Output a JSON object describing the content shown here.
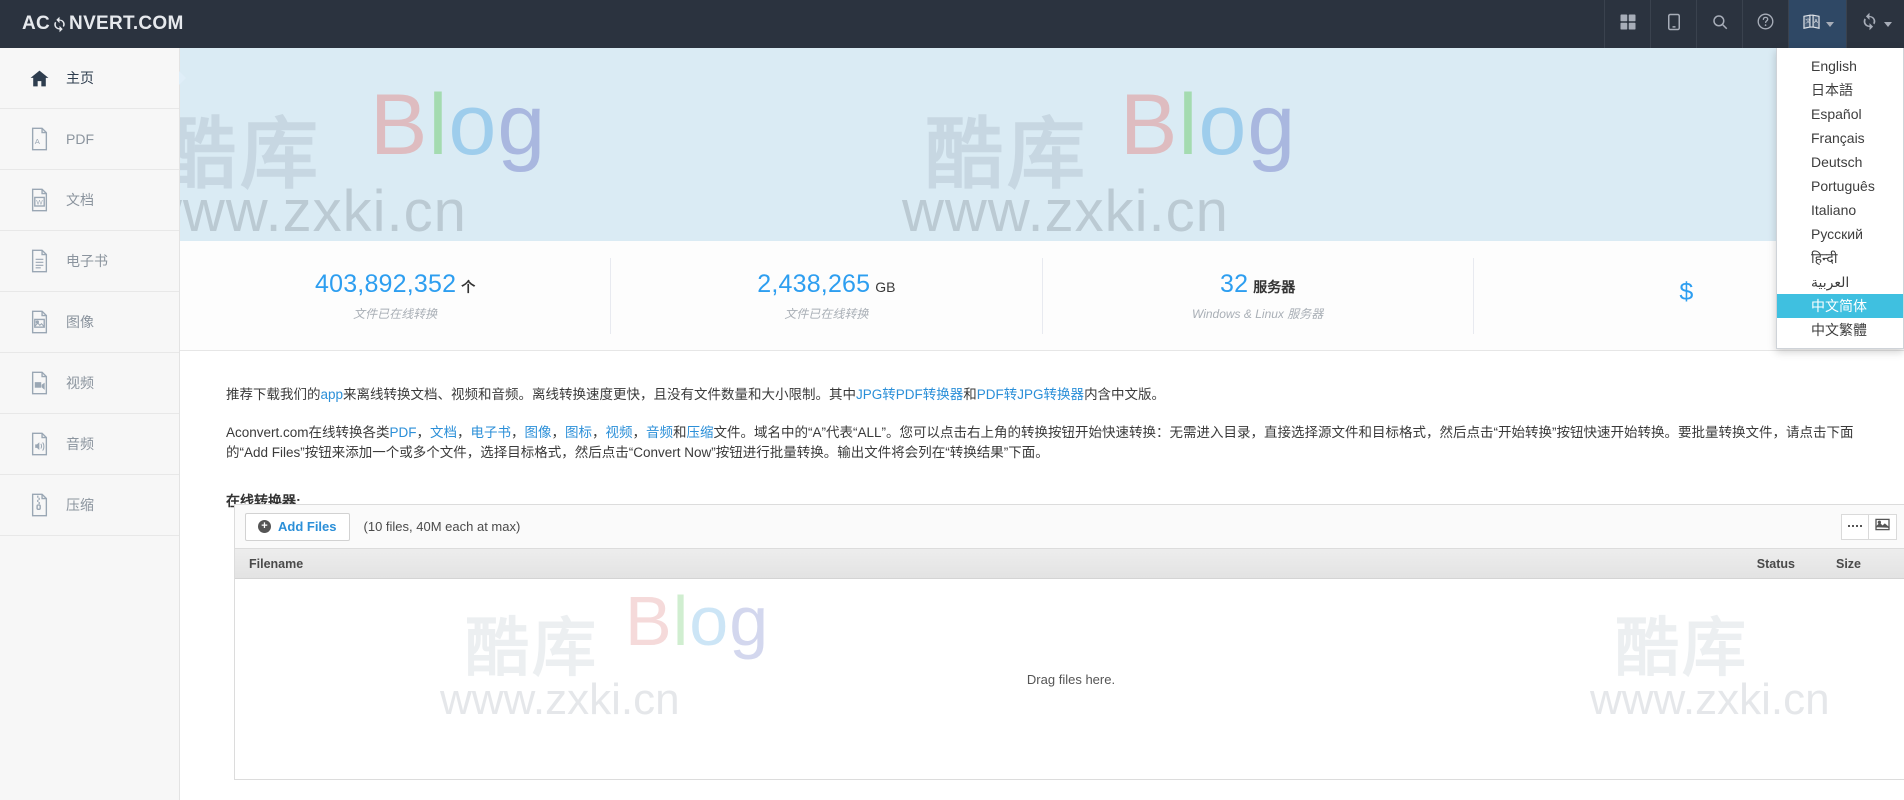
{
  "brand": {
    "prefix": "AC",
    "icon": "refresh-icon",
    "suffix": "NVERT.COM"
  },
  "topnav": {
    "icons": [
      {
        "name": "grid-icon",
        "label": "Grid"
      },
      {
        "name": "device-icon",
        "label": "Device"
      },
      {
        "name": "search-icon",
        "label": "Search"
      },
      {
        "name": "help-icon",
        "label": "Help"
      },
      {
        "name": "language-icon",
        "label": "Language",
        "active": true
      },
      {
        "name": "convert-refresh-icon",
        "label": "Convert"
      }
    ]
  },
  "language_menu": {
    "items": [
      {
        "label": "English",
        "selected": false
      },
      {
        "label": "日本語",
        "selected": false
      },
      {
        "label": "Español",
        "selected": false
      },
      {
        "label": "Français",
        "selected": false
      },
      {
        "label": "Deutsch",
        "selected": false
      },
      {
        "label": "Português",
        "selected": false
      },
      {
        "label": "Italiano",
        "selected": false
      },
      {
        "label": "Русский",
        "selected": false
      },
      {
        "label": "हिन्दी",
        "selected": false
      },
      {
        "label": "العربية",
        "selected": false
      },
      {
        "label": "中文简体",
        "selected": true
      },
      {
        "label": "中文繁體",
        "selected": false
      }
    ],
    "selected_color": "#3fc0e0"
  },
  "sidebar": {
    "items": [
      {
        "label": "主页",
        "icon": "home-icon",
        "active": true
      },
      {
        "label": "PDF",
        "icon": "pdf-file-icon",
        "active": false
      },
      {
        "label": "文档",
        "icon": "word-file-icon",
        "active": false
      },
      {
        "label": "电子书",
        "icon": "ebook-file-icon",
        "active": false
      },
      {
        "label": "图像",
        "icon": "image-file-icon",
        "active": false
      },
      {
        "label": "视频",
        "icon": "video-file-icon",
        "active": false
      },
      {
        "label": "音频",
        "icon": "audio-file-icon",
        "active": false
      },
      {
        "label": "压缩",
        "icon": "archive-file-icon",
        "active": false
      }
    ]
  },
  "banner": {
    "watermark_brand": "酷库",
    "watermark_blog": {
      "b": "B",
      "l": "l",
      "o": "o",
      "g": "g"
    },
    "watermark_url": "www.zxki.cn"
  },
  "stats": [
    {
      "number": "403,892,352",
      "unit": "个",
      "sub": "文件已在线转换"
    },
    {
      "number": "2,438,265",
      "unit": "GB",
      "sub": "文件已在线转换"
    },
    {
      "number": "32",
      "unit": "服务器",
      "sub": "Windows & Linux 服务器"
    },
    {
      "number": "$",
      "unit": "",
      "sub": ""
    }
  ],
  "content": {
    "paragraph1": {
      "t1": "推荐下载我们的",
      "link_app": "app",
      "t2": "来离线转换文档、视频和音频。离线转换速度更快，且没有文件数量和大小限制。其中",
      "link_jpg2pdf": "JPG转PDF转换器",
      "t3": "和",
      "link_pdf2jpg": "PDF转JPG转换器",
      "t4": "内含中文版。"
    },
    "paragraph2": {
      "t1": "Aconvert.com在线转换各类",
      "link_pdf": "PDF",
      "s1": "，",
      "link_doc": "文档",
      "s2": "，",
      "link_ebook": "电子书",
      "s3": "，",
      "link_image": "图像",
      "s4": "，",
      "link_icon": "图标",
      "s5": "，",
      "link_video": "视频",
      "s6": "，",
      "link_audio": "音频",
      "s7": "和",
      "link_archive": "压缩",
      "t2": "文件。域名中的“A”代表“ALL”。您可以点击右上角的转换按钮开始快速转换：无需进入目录，直接选择源文件和目标格式，然后点击“开始转换”按钮快速开始转换。要批量转换文件，请点击下面的“Add Files”按钮来添加一个或多个文件，选择目标格式，然后点击“Convert Now”按钮进行批量转换。输出文件将会列在“转换结果”下面。"
    },
    "section_title": "在线转换器:"
  },
  "converter": {
    "add_files_label": "Add Files",
    "files_note": "(10 files, 40M each at max)",
    "view_buttons": [
      {
        "name": "list-view-button"
      },
      {
        "name": "thumbnail-view-button"
      }
    ],
    "table_headers": {
      "filename": "Filename",
      "status": "Status",
      "size": "Size"
    },
    "drop_text": "Drag files here."
  },
  "colors": {
    "nav_bg": "#2b333f",
    "banner_bg": "#daebf4",
    "accent_blue": "#2d9ef0",
    "link_blue": "#2b8fd8",
    "highlight": "#3fc0e0"
  }
}
